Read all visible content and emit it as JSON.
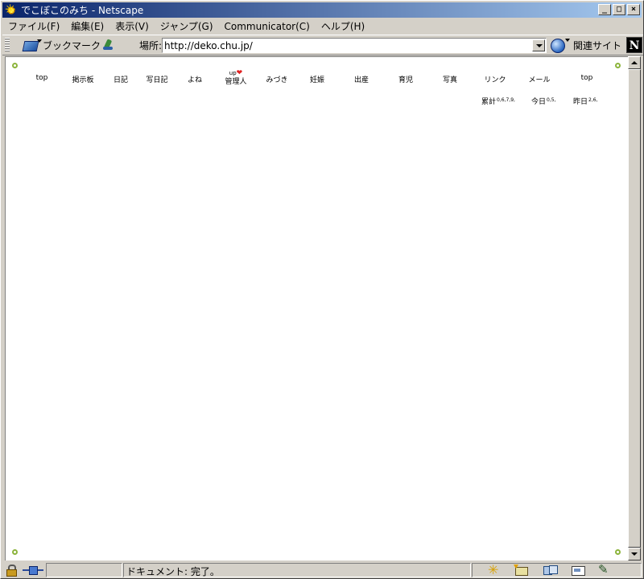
{
  "window": {
    "title": "でこぼこのみち - Netscape",
    "controls": {
      "minimize": "_",
      "maximize": "□",
      "close": "×"
    }
  },
  "menu": [
    {
      "label": "ファイル(F)"
    },
    {
      "label": "編集(E)"
    },
    {
      "label": "表示(V)"
    },
    {
      "label": "ジャンプ(G)"
    },
    {
      "label": "Communicator(C)"
    },
    {
      "label": "ヘルプ(H)"
    }
  ],
  "toolbar": {
    "bookmark_label": "ブックマーク",
    "location_label": "場所:",
    "url": "http://deko.chu.jp/",
    "related_label": "関連サイト",
    "logo_letter": "N"
  },
  "page": {
    "nav": [
      {
        "label": "top"
      },
      {
        "label": "掲示板"
      },
      {
        "label": "日記"
      },
      {
        "label": "写日記"
      },
      {
        "label": "よね"
      },
      {
        "label": "管理人",
        "prefix": "up"
      },
      {
        "label": "みづき"
      },
      {
        "label": "妊娠"
      },
      {
        "label": "出産"
      },
      {
        "label": "育児"
      },
      {
        "label": "写真"
      },
      {
        "label": "リンク"
      },
      {
        "label": "メール"
      },
      {
        "label": "top"
      }
    ],
    "counters": [
      {
        "label": "累計",
        "value": "0,6,7,9,"
      },
      {
        "label": "今日",
        "value": "0,5,"
      },
      {
        "label": "昨日",
        "value": "2,6,"
      }
    ],
    "accent_color": "#8cb43c",
    "heart_color": "#e02020"
  },
  "status": {
    "text": "ドキュメント: 完了。"
  }
}
